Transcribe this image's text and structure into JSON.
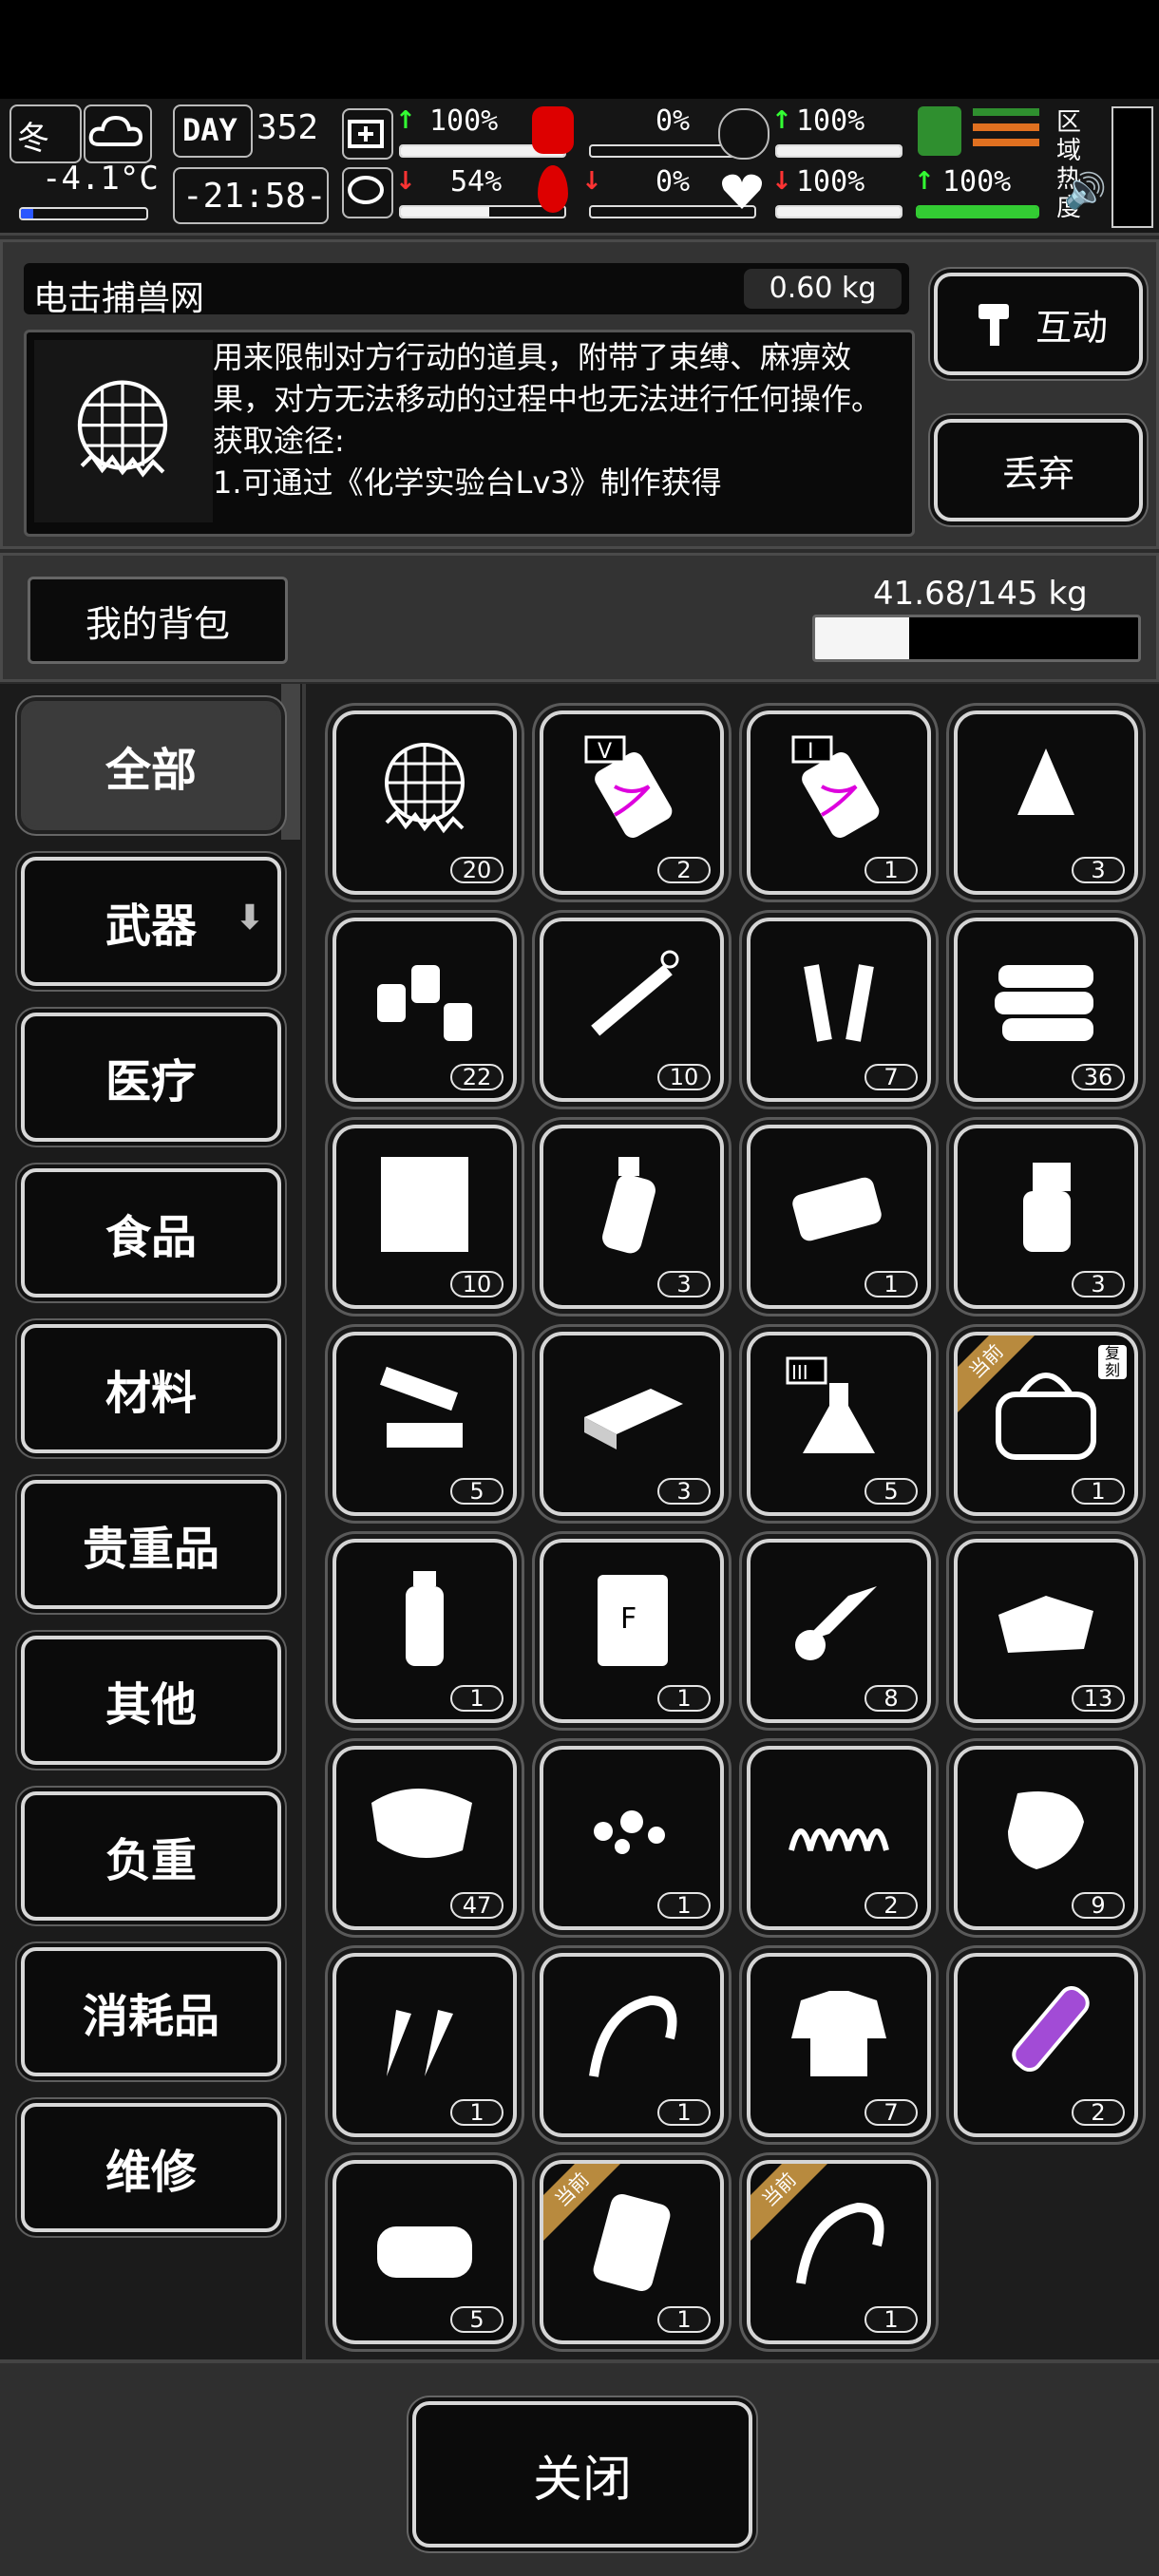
{
  "hud": {
    "season": "冬",
    "temperature": "-4.1°C",
    "day_label": "DAY",
    "day_number": "352",
    "time": "-21:58-",
    "stats": [
      {
        "value": "100%",
        "trend": "up",
        "level": 1.0
      },
      {
        "value": "0%",
        "trend": "none",
        "level": 0.0
      },
      {
        "value": "100%",
        "trend": "up",
        "level": 1.0
      },
      {
        "value": "100%",
        "trend": "none",
        "level": 1.0
      },
      {
        "value": "54%",
        "trend": "down",
        "level": 0.54
      },
      {
        "value": "0%",
        "trend": "down",
        "level": 0.0
      },
      {
        "value": "100%",
        "trend": "down",
        "level": 1.0
      },
      {
        "value": "100%",
        "trend": "up",
        "level": 1.0
      }
    ],
    "area_heat_label": "区域热度"
  },
  "item_detail": {
    "name": "电击捕兽网",
    "weight": "0.60 kg",
    "description": "用来限制对方行动的道具，附带了束缚、麻痹效果，对方无法移动的过程中也无法进行任何操作。",
    "source_label": "获取途径:",
    "source_text": "1.可通过《化学实验台Lv3》制作获得",
    "interact_button": "互动",
    "discard_button": "丢弃"
  },
  "backpack": {
    "title": "我的背包",
    "weight": "41.68/145 kg",
    "capacity_fraction": 0.29
  },
  "categories": [
    "全部",
    "武器",
    "医疗",
    "食品",
    "材料",
    "贵重品",
    "其他",
    "负重",
    "消耗品",
    "维修"
  ],
  "items": [
    {
      "icon": "net-icon",
      "count": "20",
      "tag": ""
    },
    {
      "icon": "dna-injector-v-icon",
      "count": "2",
      "tag": ""
    },
    {
      "icon": "dna-injector-i-icon",
      "count": "1",
      "tag": ""
    },
    {
      "icon": "cloth-rag-icon",
      "count": "3",
      "tag": ""
    },
    {
      "icon": "potion-bottles-icon",
      "count": "22",
      "tag": ""
    },
    {
      "icon": "syringe-icon",
      "count": "10",
      "tag": ""
    },
    {
      "icon": "ampoule-icon",
      "count": "7",
      "tag": ""
    },
    {
      "icon": "towel-stack-icon",
      "count": "36",
      "tag": ""
    },
    {
      "icon": "paper-sheet-icon",
      "count": "10",
      "tag": ""
    },
    {
      "icon": "bottle-icon",
      "count": "3",
      "tag": ""
    },
    {
      "icon": "soap-icon",
      "count": "1",
      "tag": ""
    },
    {
      "icon": "spray-bottle-icon",
      "count": "3",
      "tag": ""
    },
    {
      "icon": "tools-parts-icon",
      "count": "5",
      "tag": ""
    },
    {
      "icon": "brick-icon",
      "count": "3",
      "tag": ""
    },
    {
      "icon": "flask-iii-icon",
      "count": "5",
      "tag": ""
    },
    {
      "icon": "bag-icon",
      "count": "1",
      "tag": "当前",
      "badge": "复刻"
    },
    {
      "icon": "water-bottle-icon",
      "count": "1",
      "tag": ""
    },
    {
      "icon": "flour-bag-icon",
      "count": "1",
      "tag": ""
    },
    {
      "icon": "roll-icon",
      "count": "8",
      "tag": ""
    },
    {
      "icon": "fabric-icon",
      "count": "13",
      "tag": ""
    },
    {
      "icon": "meat-chunk-icon",
      "count": "47",
      "tag": ""
    },
    {
      "icon": "rubble-icon",
      "count": "1",
      "tag": ""
    },
    {
      "icon": "spring-icon",
      "count": "2",
      "tag": ""
    },
    {
      "icon": "steak-icon",
      "count": "9",
      "tag": ""
    },
    {
      "icon": "carrot-icon",
      "count": "1",
      "tag": ""
    },
    {
      "icon": "bone-whip-icon",
      "count": "1",
      "tag": ""
    },
    {
      "icon": "torn-shirt-icon",
      "count": "7",
      "tag": ""
    },
    {
      "icon": "test-tube-icon",
      "count": "2",
      "tag": ""
    },
    {
      "icon": "folded-cloth-icon",
      "count": "5",
      "tag": ""
    },
    {
      "icon": "backpack-small-icon",
      "count": "1",
      "tag": "当前"
    },
    {
      "icon": "bone-whip-icon",
      "count": "1",
      "tag": "当前"
    }
  ],
  "close_button": "关闭"
}
